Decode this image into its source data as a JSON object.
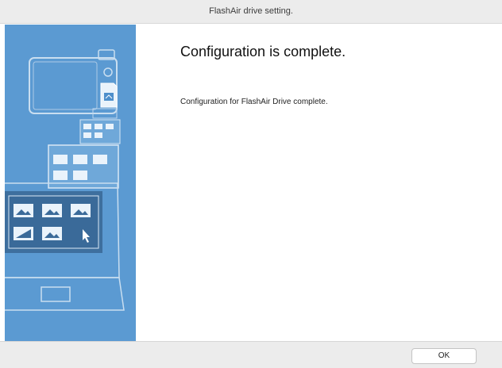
{
  "window": {
    "title": "FlashAir drive setting."
  },
  "main": {
    "heading": "Configuration is complete.",
    "message": "Configuration for FlashAir Drive complete."
  },
  "footer": {
    "ok_label": "OK"
  },
  "colors": {
    "sidebar_background": "#5b9ad2",
    "window_chrome": "#ececec"
  },
  "icons": [
    "flashair-illustration",
    "camera-icon",
    "sd-card-icon",
    "photo-thumbnail-icon",
    "laptop-icon",
    "cursor-arrow-icon"
  ]
}
